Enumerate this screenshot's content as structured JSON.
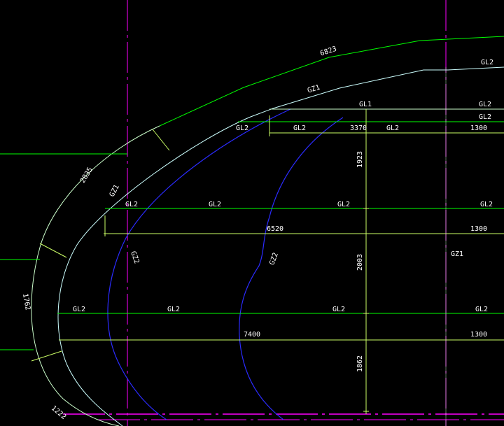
{
  "colors": {
    "background": "#000000",
    "magenta_axis": "#ff00ff",
    "green_line": "#00ff00",
    "light_green": "#ccffcc",
    "cyan_line": "#ccffff",
    "blue_curve": "#2b2bff",
    "yellow_green": "#ccff66",
    "label": "#ffffff"
  },
  "labels": {
    "d6823": "6823",
    "gz1_top": "GZ1",
    "gl1_top": "GL1",
    "gl2_tr1": "GL2",
    "gl2_tr2": "GL2",
    "gl2_tr3": "GL2",
    "gl2_r1a": "GL2",
    "gl2_r1b": "GL2",
    "d3370": "3370",
    "gl2_r1c": "GL2",
    "d1300_1": "1300",
    "d2835": "2835",
    "d1923": "1923",
    "gz1_left": "GZ1",
    "gl2_r2a": "GL2",
    "gl2_r2b": "GL2",
    "gl2_r2c": "GL2",
    "gl2_r2d": "GL2",
    "d6520": "6520",
    "d1300_2": "1300",
    "gz2_a": "GZ2",
    "gz2_b": "GZ2",
    "d2003": "2003",
    "gz1_right": "GZ1",
    "d1762": "1762",
    "gl2_r3a": "GL2",
    "gl2_r3b": "GL2",
    "gl2_r3c": "GL2",
    "gl2_r3d": "GL2",
    "d7400": "7400",
    "d1300_3": "1300",
    "d1862": "1862",
    "d1222": "1222"
  }
}
